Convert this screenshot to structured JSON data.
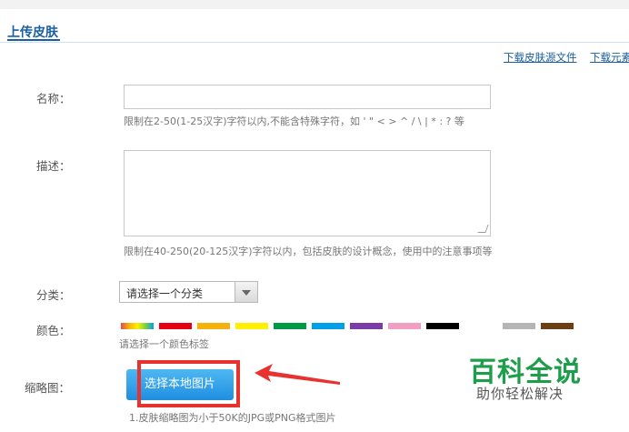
{
  "header": {
    "title": "上传皮肤"
  },
  "links": {
    "download_skin_source": "下载皮肤源文件",
    "download_elements": "下载元素"
  },
  "form": {
    "name_label": "名称：",
    "name_value": "",
    "name_hint": "限制在2-50(1-25汉字)字符以内,不能含特殊字符，如 ' \" < > ^ / \\ | * : ? 等",
    "desc_label": "描述：",
    "desc_value": "",
    "desc_hint": "限制在40-250(20-125汉字)字符以内，包括皮肤的设计概念，使用中的注意事项等",
    "category_label": "分类：",
    "category_selected": "请选择一个分类",
    "color_label": "颜色：",
    "color_hint": "请选择一个颜色标签",
    "colors": [
      "#e44d4d",
      "#e60012",
      "#f5b10c",
      "#fff000",
      "#009944",
      "#00a0e9",
      "#7b3ba8",
      "#f29ec2",
      "#000000",
      "#ffffff",
      "#b5b5b5",
      "#6b3f12"
    ],
    "thumb_label": "缩略图：",
    "upload_button": "选择本地图片",
    "thumb_hint": "1.皮肤缩略图为小于50K的JPG或PNG格式图片"
  },
  "watermark": {
    "title": "百科全说",
    "subtitle": "助你轻松解决"
  },
  "accent_color": "#1a5fa0",
  "highlight_color": "#e8322f"
}
